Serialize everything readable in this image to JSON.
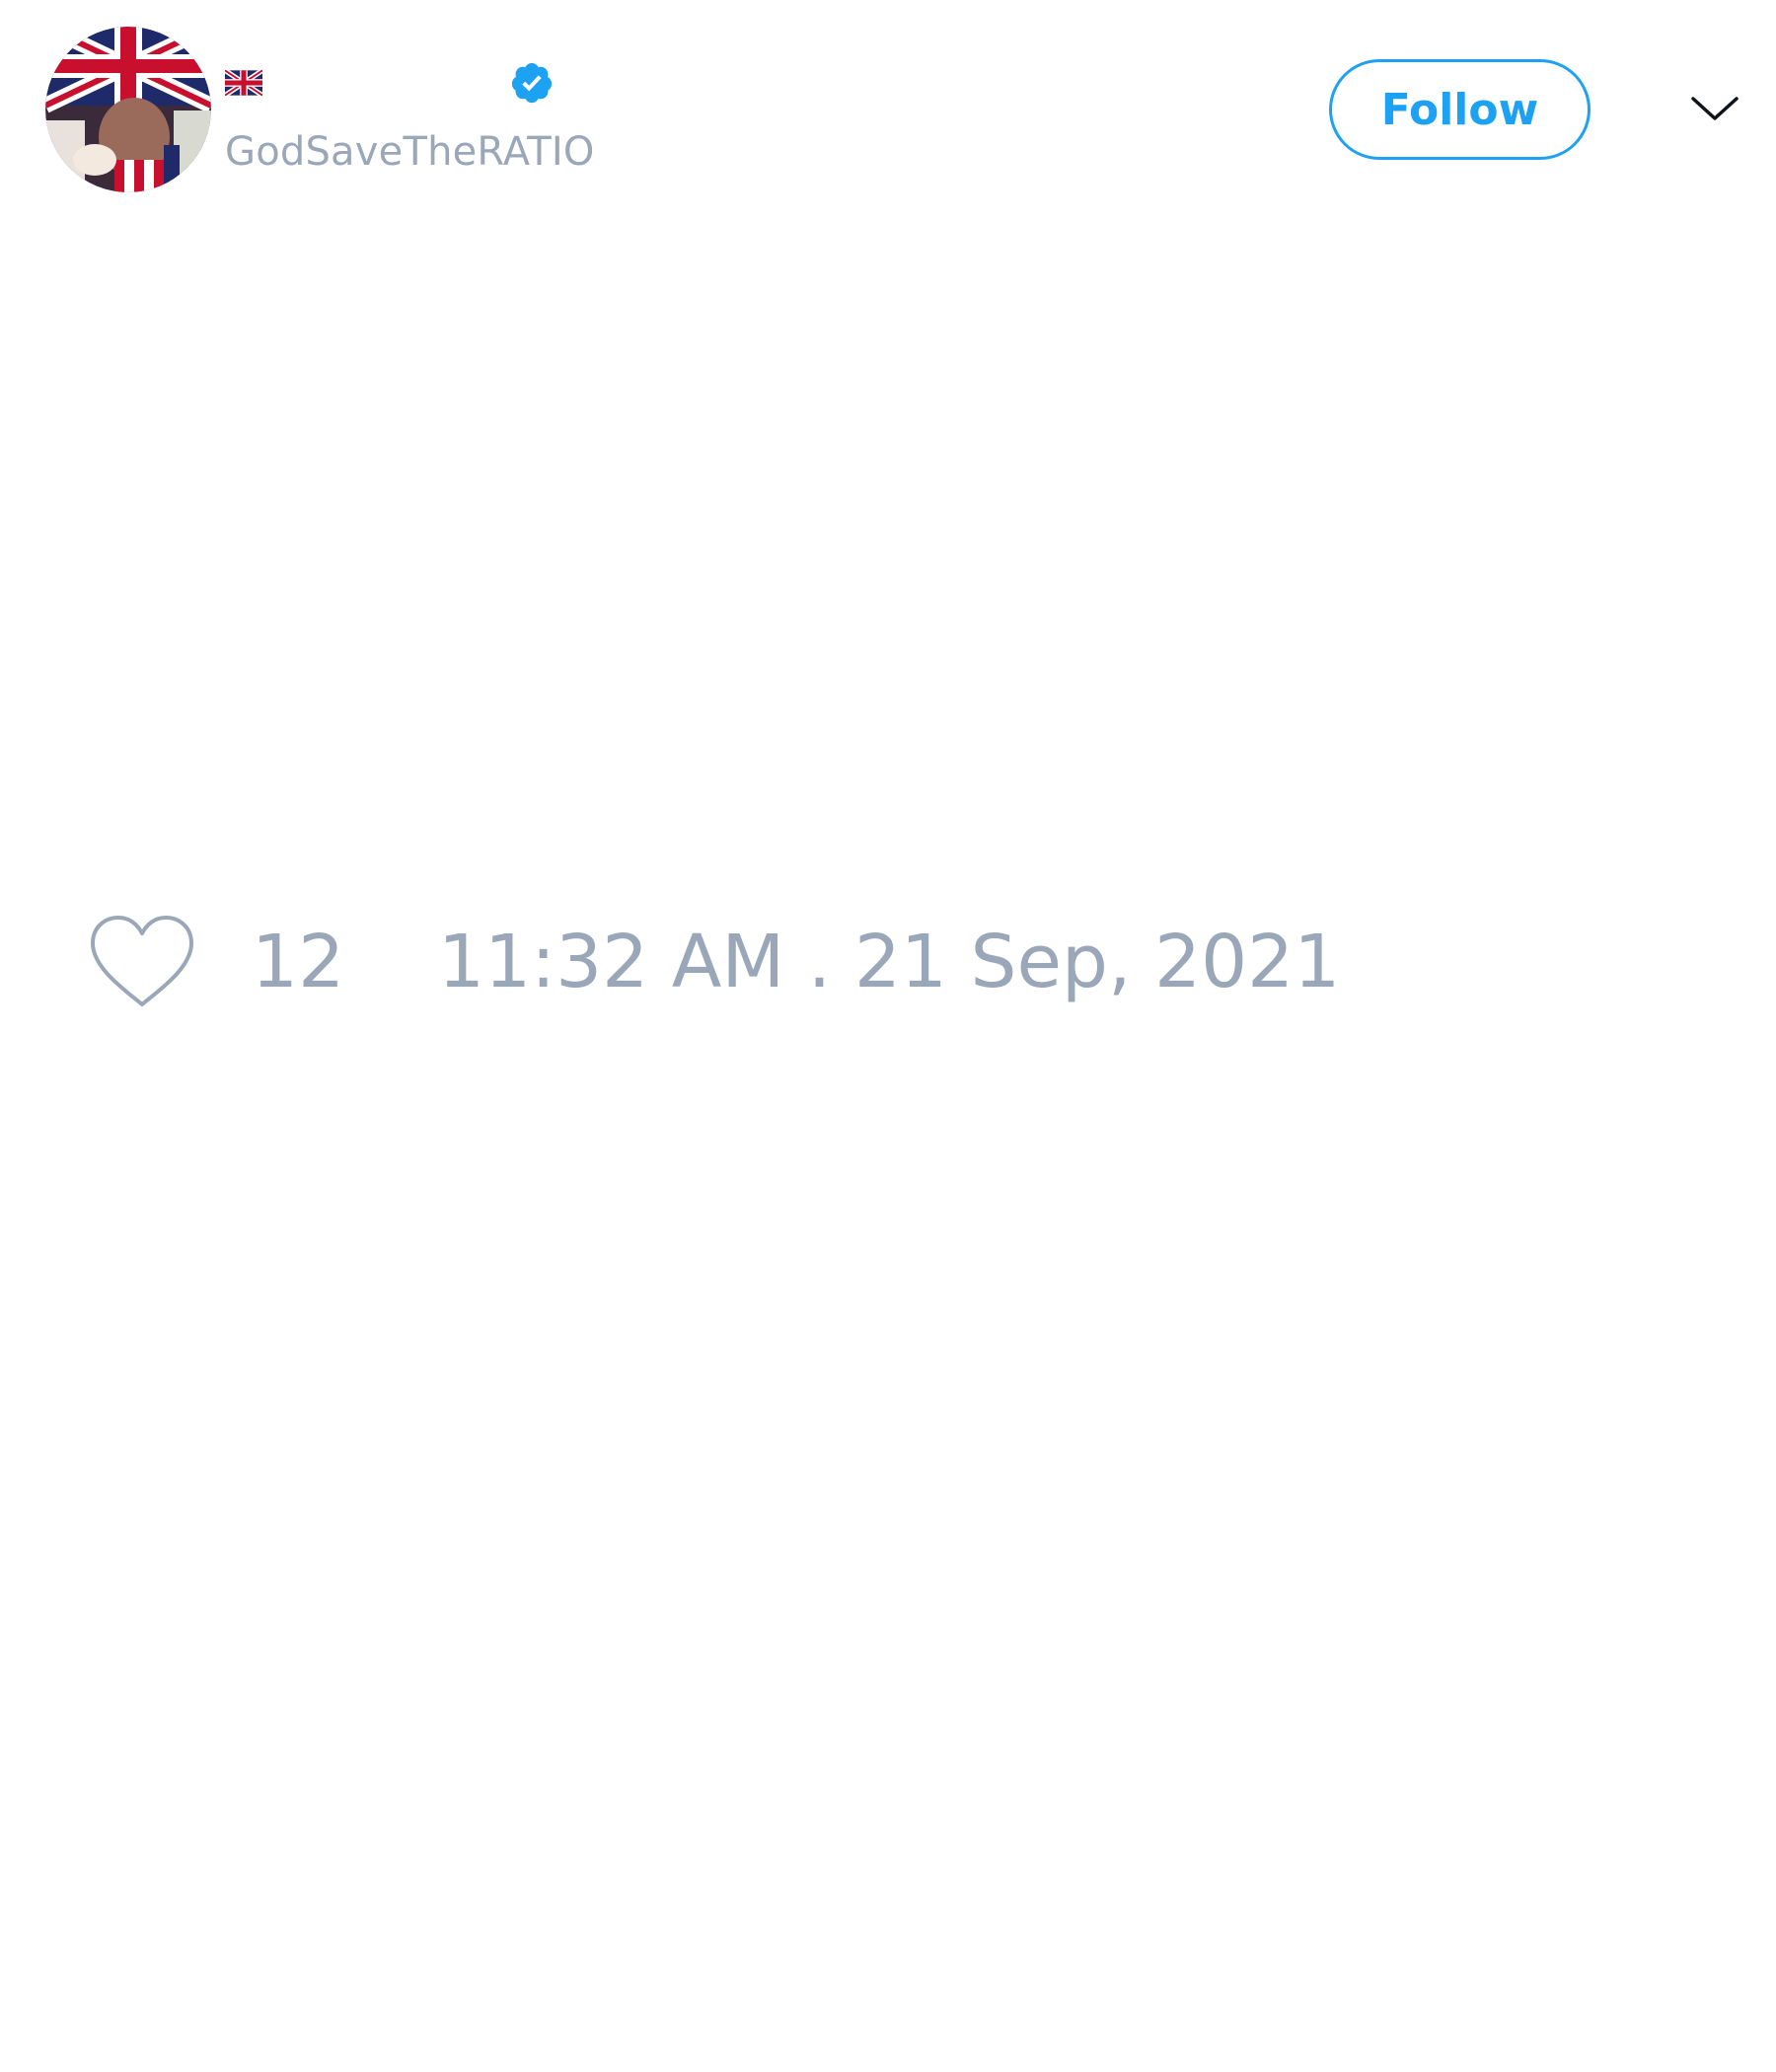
{
  "tweet": {
    "author": {
      "handle": "GodSaveTheRATIO",
      "name_flag": "flag-gb-icon",
      "verified": true,
      "avatar": "avatar-union-jack-photo"
    },
    "follow_label": "Follow",
    "menu_icon": "chevron-down-icon",
    "likes": {
      "icon": "heart-icon",
      "count": "12"
    },
    "timestamp": "11:32 AM . 21 Sep, 2021"
  },
  "colors": {
    "accent": "#1da1f2",
    "muted_text": "#9aa7b8",
    "background": "#ffffff"
  }
}
